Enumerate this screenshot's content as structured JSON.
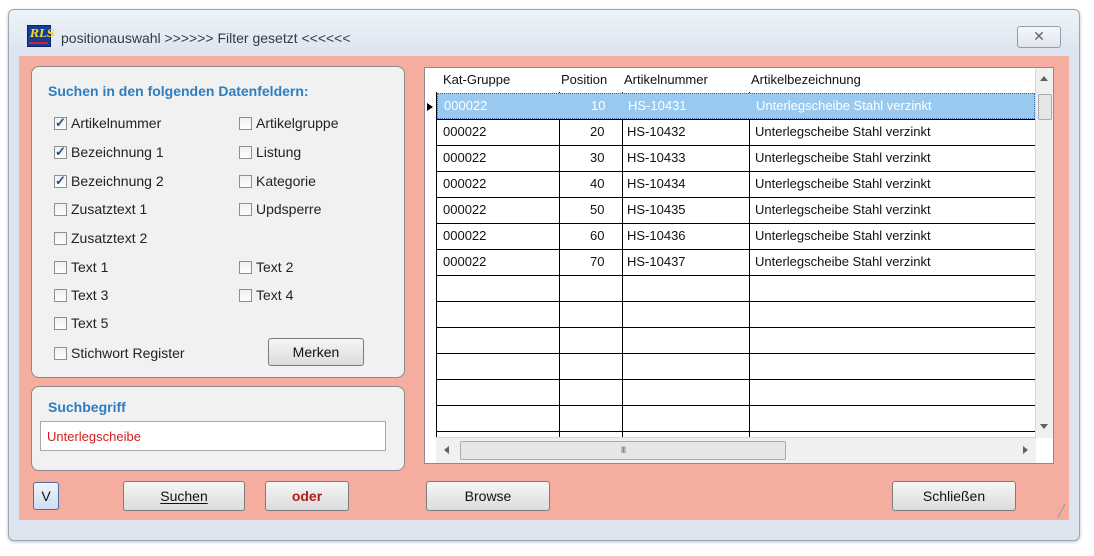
{
  "window": {
    "title": "positionauswahl >>>>>> Filter gesetzt <<<<<<",
    "app_icon_text": "RLS",
    "close_label": "✕"
  },
  "fields_panel": {
    "title": "Suchen in den folgenden Datenfeldern:",
    "checkboxes": [
      {
        "label": "Artikelnummer",
        "checked": true
      },
      {
        "label": "Artikelgruppe",
        "checked": false
      },
      {
        "label": "Bezeichnung 1",
        "checked": true
      },
      {
        "label": "Listung",
        "checked": false
      },
      {
        "label": "Bezeichnung 2",
        "checked": true
      },
      {
        "label": "Kategorie",
        "checked": false
      },
      {
        "label": "Zusatztext 1",
        "checked": false
      },
      {
        "label": "Updsperre",
        "checked": false
      },
      {
        "label": "Zusatztext 2",
        "checked": false
      },
      {
        "label": "Text 1",
        "checked": false
      },
      {
        "label": "Text 2",
        "checked": false
      },
      {
        "label": "Text 3",
        "checked": false
      },
      {
        "label": "Text 4",
        "checked": false
      },
      {
        "label": "Text 5",
        "checked": false
      },
      {
        "label": "Stichwort Register",
        "checked": false
      }
    ],
    "merken_label": "Merken"
  },
  "search_panel": {
    "title": "Suchbegriff",
    "value": "Unterlegscheibe"
  },
  "buttons": {
    "v_label": "V",
    "suchen_label": "Suchen",
    "oder_label": "oder",
    "browse_label": "Browse",
    "schliessen_label": "Schließen"
  },
  "grid": {
    "columns": [
      "Kat-Gruppe",
      "Position",
      "Artikelnummer",
      "Artikelbezeichnung"
    ],
    "rows": [
      [
        "000022",
        "10",
        "HS-10431",
        "Unterlegscheibe Stahl verzinkt"
      ],
      [
        "000022",
        "20",
        "HS-10432",
        "Unterlegscheibe Stahl verzinkt"
      ],
      [
        "000022",
        "30",
        "HS-10433",
        "Unterlegscheibe Stahl verzinkt"
      ],
      [
        "000022",
        "40",
        "HS-10434",
        "Unterlegscheibe Stahl verzinkt"
      ],
      [
        "000022",
        "50",
        "HS-10435",
        "Unterlegscheibe Stahl verzinkt"
      ],
      [
        "000022",
        "60",
        "HS-10436",
        "Unterlegscheibe Stahl verzinkt"
      ],
      [
        "000022",
        "70",
        "HS-10437",
        "Unterlegscheibe Stahl verzinkt"
      ]
    ],
    "selected_row": 0,
    "hscroll_thumb_label": "III"
  },
  "colors": {
    "client_bg": "#f4ad9f",
    "panel_title": "#2d7dbf",
    "oder_text": "#b0201a",
    "search_text": "#d22020",
    "selection": "#99c9ef"
  }
}
